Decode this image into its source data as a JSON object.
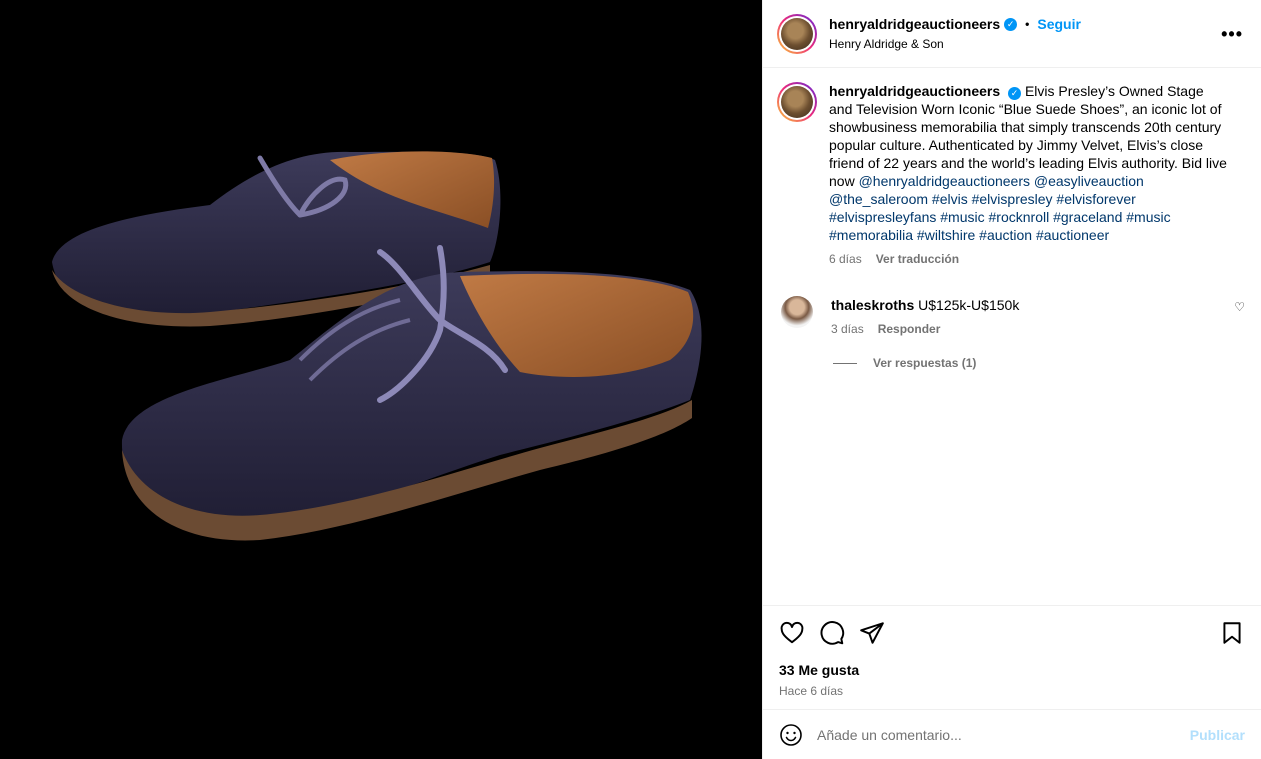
{
  "post": {
    "username": "henryaldridgeauctioneers",
    "verified_mark": "✓",
    "follow_label": "Seguir",
    "subtitle": "Henry Aldridge & Son",
    "more_label": "•••",
    "caption": {
      "username": "henryaldridgeauctioneers",
      "text": "Elvis Presley’s Owned Stage and Television Worn Iconic “Blue Suede Shoes”, an iconic lot of showbusiness memorabilia that simply transcends 20th century popular culture. Authenticated by Jimmy Velvet, Elvis’s close friend of 22 years and the world’s leading Elvis authority. Bid live now ",
      "tags": "@henryaldridgeauctioneers @easyliveauction @the_saleroom #elvis #elvispresley #elvisforever #elvispresleyfans #music #rocknroll #graceland #music #memorabilia #wiltshire #auction #auctioneer",
      "time": "6 días",
      "translate": "Ver traducción"
    },
    "comments": [
      {
        "username": "thaleskroths",
        "text": "U$125k-U$150k",
        "time": "3 días",
        "reply": "Responder",
        "view_replies": "Ver respuestas (1)"
      }
    ],
    "likes": "33 Me gusta",
    "ago": "Hace 6 días",
    "composer": {
      "placeholder": "Añade un comentario...",
      "publish": "Publicar"
    },
    "icons": {
      "like": "heart-icon",
      "comment": "comment-icon",
      "share": "send-icon",
      "save": "bookmark-icon",
      "emoji": "emoji-icon",
      "more": "more-options-icon"
    },
    "colors": {
      "accent": "#0095f6",
      "link": "#00376b",
      "muted": "#737373",
      "publish_disabled": "#b2dffc"
    }
  }
}
